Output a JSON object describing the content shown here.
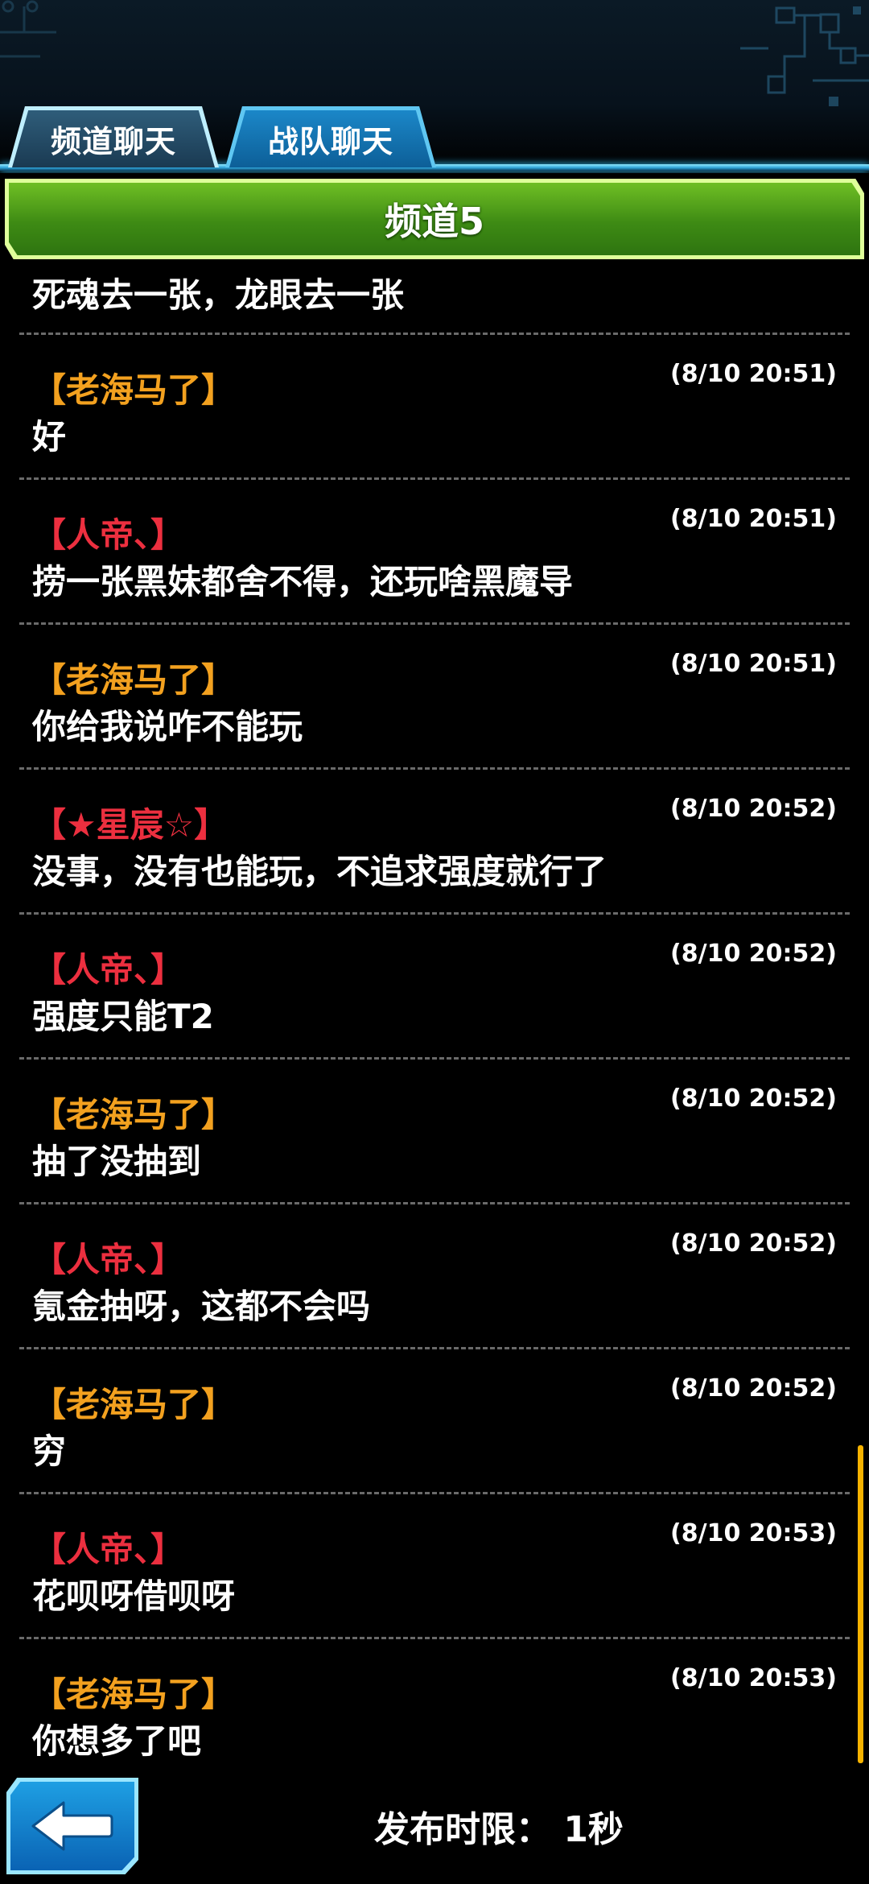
{
  "tabs": [
    {
      "label": "频道聊天",
      "active": true
    },
    {
      "label": "战队聊天",
      "active": false
    }
  ],
  "channel": {
    "title": "频道5"
  },
  "messages": {
    "first_partial": "死魂去一张，龙眼去一张",
    "items": [
      {
        "name": "【老海马了】",
        "time": "(8/10 20:51)",
        "text": "好",
        "name_color": "#f3a11f"
      },
      {
        "name": "【人帝、】",
        "time": "(8/10 20:51)",
        "text": "捞一张黑妹都舍不得，还玩啥黑魔导",
        "name_color": "#ec2f3f"
      },
      {
        "name": "【老海马了】",
        "time": "(8/10 20:51)",
        "text": "你给我说咋不能玩",
        "name_color": "#f3a11f"
      },
      {
        "name": "【★星宸☆】",
        "time": "(8/10 20:52)",
        "text": "没事，没有也能玩，不追求强度就行了",
        "name_color": "#ec2f3f"
      },
      {
        "name": "【人帝、】",
        "time": "(8/10 20:52)",
        "text": "强度只能T2",
        "name_color": "#ec2f3f"
      },
      {
        "name": "【老海马了】",
        "time": "(8/10 20:52)",
        "text": "抽了没抽到",
        "name_color": "#f3a11f"
      },
      {
        "name": "【人帝、】",
        "time": "(8/10 20:52)",
        "text": "氪金抽呀，这都不会吗",
        "name_color": "#ec2f3f"
      },
      {
        "name": "【老海马了】",
        "time": "(8/10 20:52)",
        "text": "穷",
        "name_color": "#f3a11f"
      },
      {
        "name": "【人帝、】",
        "time": "(8/10 20:53)",
        "text": "花呗呀借呗呀",
        "name_color": "#ec2f3f"
      },
      {
        "name": "【老海马了】",
        "time": "(8/10 20:53)",
        "text": "你想多了吧",
        "name_color": "#f3a11f"
      }
    ]
  },
  "footer": {
    "back_icon": "arrow-left-icon",
    "post_limit": "发布时限： 1秒"
  },
  "colors": {
    "accent_blue": "#2ea3d8",
    "banner_green": "#4e9c1a",
    "name_orange": "#f3a11f",
    "name_red": "#ec2f3f",
    "scrollbar": "#f6b300"
  }
}
